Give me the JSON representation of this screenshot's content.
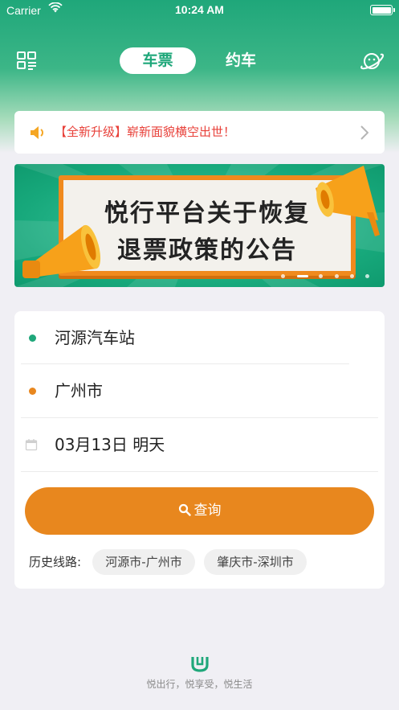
{
  "status_bar": {
    "carrier": "Carrier",
    "time": "10:24 AM"
  },
  "nav": {
    "tabs": [
      {
        "label": "车票",
        "active": true
      },
      {
        "label": "约车",
        "active": false
      }
    ],
    "left_icon": "grid-menu-icon",
    "right_icon": "planet-icon"
  },
  "notice": {
    "text": "【全新升级】崭新面貌横空出世！",
    "icon": "speaker-icon",
    "text_color": "#e8413a"
  },
  "banner": {
    "line1": "悦行平台关于恢复",
    "line2": "退票政策的公告",
    "slide_count": 6,
    "active_slide": 2
  },
  "search": {
    "from": "河源汽车站",
    "to": "广州市",
    "date": "03月13日 明天",
    "from_color": "#1fa77a",
    "to_color": "#e8871e",
    "query_label": "查询",
    "button_color": "#e8871e"
  },
  "history": {
    "label": "历史线路:",
    "routes": [
      "河源市-广州市",
      "肇庆市-深圳市"
    ]
  },
  "footer": {
    "slogan": "悦出行，悦享受，悦生活"
  },
  "colors": {
    "brand_green": "#1fa77a",
    "accent_orange": "#e8871e",
    "page_bg": "#f0eff4"
  }
}
